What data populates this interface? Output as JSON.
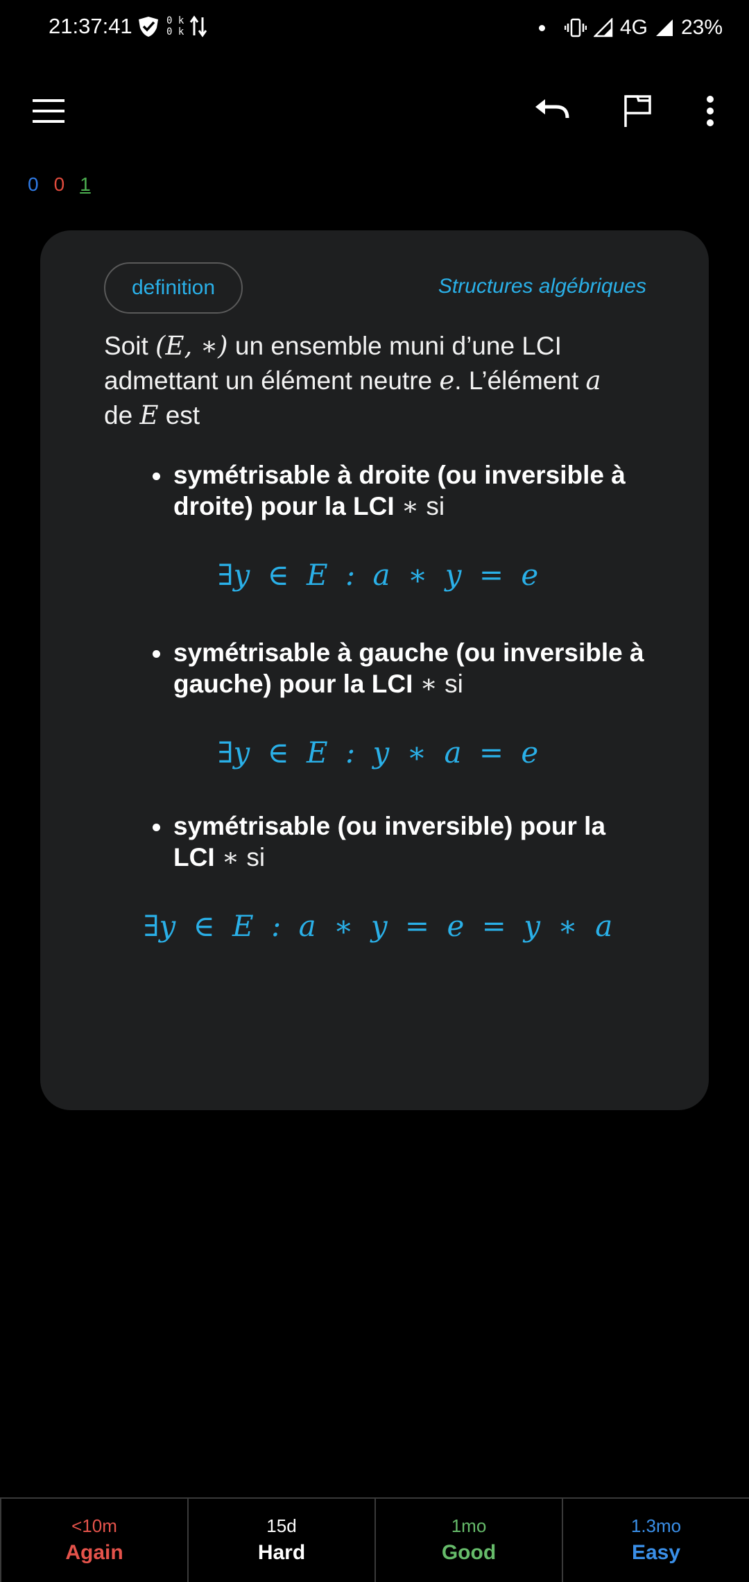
{
  "status_bar": {
    "time": "21:37:41",
    "net_up": "0 k",
    "net_down": "0 k",
    "network": "4G",
    "battery": "23%"
  },
  "toolbar": {
    "icons": [
      "menu-icon",
      "undo-icon",
      "flag-icon",
      "more-vert-icon"
    ]
  },
  "counts": {
    "new": "0",
    "learning": "0",
    "review": "1"
  },
  "card": {
    "tag": "definition",
    "deck": "Structures algébriques",
    "intro": {
      "p1": "Soit ",
      "m1": "(E, ∗)",
      "p2": " un ensemble muni d’une LCI admettant un élément neutre ",
      "m2": "e",
      "p3": ". L’élément ",
      "m3": "a",
      "p4": " de ",
      "m4": "E",
      "p5": " est"
    },
    "bullets": [
      {
        "title": "symétrisable à droite (ou inversible à droite) pour la LCI",
        "symbol": "∗",
        "suffix": "si",
        "formula": "∃y ∈ E : a ∗ y = e"
      },
      {
        "title": "symétrisable à gauche (ou inversible à gauche) pour la LCI",
        "symbol": "∗",
        "suffix": "si",
        "formula": "∃y ∈ E : y ∗ a = e"
      },
      {
        "title": "symétrisable (ou inversible) pour la LCI",
        "symbol": "∗",
        "suffix": "si",
        "formula": "∃y ∈ E : a ∗ y = e = y ∗ a"
      }
    ]
  },
  "answers": [
    {
      "interval": "<10m",
      "label": "Again",
      "color": "#e5534b"
    },
    {
      "interval": "15d",
      "label": "Hard",
      "color": "#ffffff"
    },
    {
      "interval": "1mo",
      "label": "Good",
      "color": "#66bb6a"
    },
    {
      "interval": "1.3mo",
      "label": "Easy",
      "color": "#3a8fe8"
    }
  ],
  "colors": {
    "accent": "#2ab0e8",
    "card_bg": "#1e1f20",
    "background": "#000000"
  }
}
